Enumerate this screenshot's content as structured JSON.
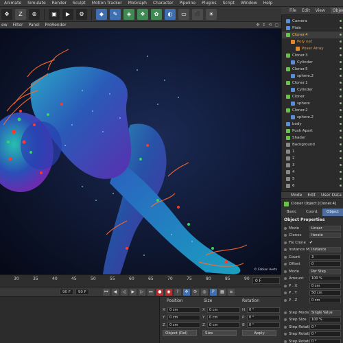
{
  "menubar": [
    "Animate",
    "Simulate",
    "Render",
    "Sculpt",
    "Motion Tracker",
    "MoGraph",
    "Character",
    "Pipeline",
    "Plugins",
    "Script",
    "Window",
    "Help"
  ],
  "toolbar": {
    "icons": [
      "move-tool",
      "z-axis-lock",
      "world-coordinates",
      "render-view",
      "render-picture-viewer",
      "render-settings",
      "cube-primitive",
      "spline-pen",
      "subdivision-surface",
      "array-generator",
      "mograph-cloner",
      "deformer",
      "floor",
      "camera",
      "light"
    ],
    "z_label": "Z"
  },
  "viewport": {
    "tabs": [
      "ew",
      "Filter",
      "Panel",
      "ProRender"
    ],
    "credit": "© Fabian Aerts"
  },
  "timeline": {
    "ticks": [
      "30",
      "35",
      "40",
      "45",
      "50",
      "55",
      "60",
      "65",
      "70",
      "75",
      "80",
      "85",
      "90"
    ],
    "current_frame": "0 F"
  },
  "playback": {
    "start": "90 F",
    "end": "90 F"
  },
  "coords": {
    "headers": [
      "Position",
      "Size",
      "Rotation"
    ],
    "rows": [
      {
        "axis": "X",
        "pos": "0 cm",
        "size_axis": "X",
        "size": "0 cm",
        "rot_axis": "H",
        "rot": "0 °"
      },
      {
        "axis": "Y",
        "pos": "0 cm",
        "size_axis": "Y",
        "size": "0 cm",
        "rot_axis": "P",
        "rot": "0 °"
      },
      {
        "axis": "Z",
        "pos": "0 cm",
        "size_axis": "Z",
        "size": "0 cm",
        "rot_axis": "B",
        "rot": "0 °"
      }
    ],
    "mode_dropdown": "Object (Rel)",
    "size_dropdown": "Size",
    "apply_label": "Apply"
  },
  "objects_panel": {
    "tabs": [
      "File",
      "Edit",
      "View",
      "Objects"
    ],
    "items": [
      {
        "name": "Camera",
        "indent": 0,
        "color": "#d0d0d0",
        "icon": "#5a8fd8"
      },
      {
        "name": "Plain",
        "indent": 0,
        "color": "#d0d0d0",
        "icon": "#5a8fd8"
      },
      {
        "name": "Cloner.4",
        "indent": 0,
        "color": "#f0c040",
        "icon": "#6bbf4e",
        "selected": true
      },
      {
        "name": "Poly net",
        "indent": 1,
        "color": "#f0a030",
        "icon": "#e08a2a"
      },
      {
        "name": "Poser Array",
        "indent": 2,
        "color": "#f0a030",
        "icon": "#e08a2a"
      },
      {
        "name": "Cloner.3",
        "indent": 0,
        "color": "#d0d0d0",
        "icon": "#6bbf4e"
      },
      {
        "name": "Cylinder",
        "indent": 1,
        "color": "#d0d0d0",
        "icon": "#5a8fd8"
      },
      {
        "name": "Cloner.5",
        "indent": 0,
        "color": "#d0d0d0",
        "icon": "#6bbf4e"
      },
      {
        "name": "sphere.2",
        "indent": 1,
        "color": "#d0d0d0",
        "icon": "#5a8fd8"
      },
      {
        "name": "Cloner.1",
        "indent": 0,
        "color": "#d0d0d0",
        "icon": "#6bbf4e"
      },
      {
        "name": "Cylinder",
        "indent": 1,
        "color": "#d0d0d0",
        "icon": "#5a8fd8"
      },
      {
        "name": "Cloner",
        "indent": 0,
        "color": "#d0d0d0",
        "icon": "#6bbf4e"
      },
      {
        "name": "sphere",
        "indent": 1,
        "color": "#d0d0d0",
        "icon": "#5a8fd8"
      },
      {
        "name": "Cloner.2",
        "indent": 0,
        "color": "#d0d0d0",
        "icon": "#6bbf4e"
      },
      {
        "name": "sphere.2",
        "indent": 1,
        "color": "#d0d0d0",
        "icon": "#5a8fd8"
      },
      {
        "name": "body",
        "indent": 0,
        "color": "#d0d0d0",
        "icon": "#5a8fd8"
      },
      {
        "name": "Push Apart",
        "indent": 0,
        "color": "#d0d0d0",
        "icon": "#6bbf4e"
      },
      {
        "name": "Shader",
        "indent": 0,
        "color": "#d0d0d0",
        "icon": "#6bbf4e"
      },
      {
        "name": "Background",
        "indent": 0,
        "color": "#d0d0d0",
        "icon": "#888888"
      },
      {
        "name": "1",
        "indent": 0,
        "color": "#d0d0d0",
        "icon": "#888888"
      },
      {
        "name": "2",
        "indent": 0,
        "color": "#d0d0d0",
        "icon": "#888888"
      },
      {
        "name": "3",
        "indent": 0,
        "color": "#d0d0d0",
        "icon": "#888888"
      },
      {
        "name": "4",
        "indent": 0,
        "color": "#d0d0d0",
        "icon": "#888888"
      },
      {
        "name": "5",
        "indent": 0,
        "color": "#d0d0d0",
        "icon": "#888888"
      },
      {
        "name": "6",
        "indent": 0,
        "color": "#d0d0d0",
        "icon": "#888888"
      }
    ]
  },
  "attributes": {
    "tabs": [
      "Mode",
      "Edit",
      "User Data"
    ],
    "title": "Cloner Object [Cloner.4]",
    "sub_tabs": [
      "Basic",
      "Coord.",
      "Object"
    ],
    "section1": "Object Properties",
    "section1_rows": [
      {
        "label": "Mode",
        "value": "Linear",
        "kind": "drop"
      },
      {
        "label": "Clones",
        "value": "Iterate",
        "kind": "drop"
      },
      {
        "label": "Fix Clone",
        "value": "✔",
        "kind": "check"
      },
      {
        "label": "Instance Mode",
        "value": "Instance",
        "kind": "drop"
      },
      {
        "label": "Count",
        "value": "3",
        "kind": "field"
      },
      {
        "label": "Offset",
        "value": "0",
        "kind": "field"
      },
      {
        "label": "Mode",
        "value": "Per Step",
        "kind": "drop"
      },
      {
        "label": "Amount",
        "value": "100 %",
        "kind": "field"
      },
      {
        "label": "P . X",
        "value": "0 cm",
        "kind": "field"
      },
      {
        "label": "P . Y",
        "value": "50 cm",
        "kind": "field"
      },
      {
        "label": "P . Z",
        "value": "0 cm",
        "kind": "field"
      }
    ],
    "section2_rows": [
      {
        "label": "Step Mode",
        "value": "Single Value",
        "kind": "drop"
      },
      {
        "label": "Step Size",
        "value": "100 %",
        "kind": "field"
      },
      {
        "label": "Step Rotation . H",
        "value": "0 °",
        "kind": "field"
      },
      {
        "label": "Step Rotation . P",
        "value": "0 °",
        "kind": "field"
      },
      {
        "label": "Step Rotation . B",
        "value": "0 °",
        "kind": "field"
      }
    ]
  }
}
